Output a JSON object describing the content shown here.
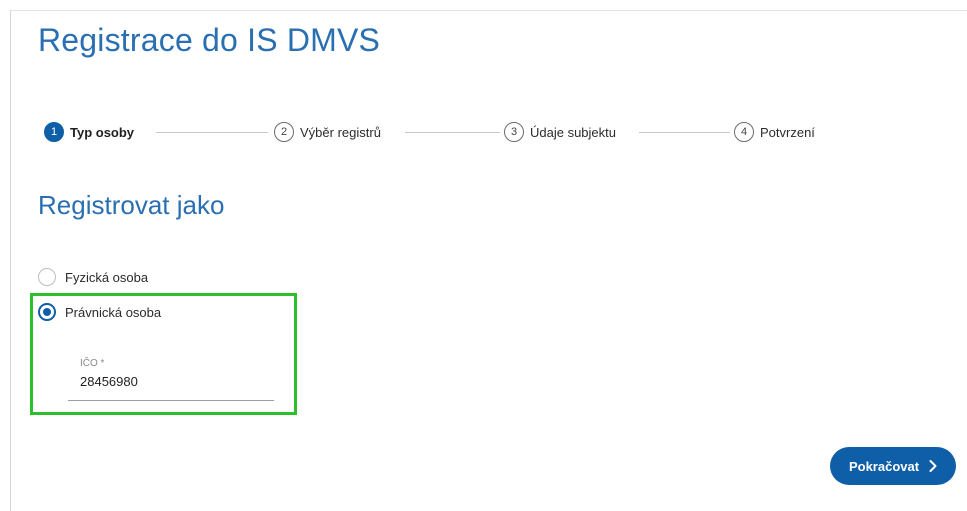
{
  "page": {
    "title": "Registrace do IS DMVS"
  },
  "stepper": {
    "steps": [
      {
        "number": "1",
        "label": "Typ osoby",
        "active": true
      },
      {
        "number": "2",
        "label": "Výběr registrů",
        "active": false
      },
      {
        "number": "3",
        "label": "Údaje subjektu",
        "active": false
      },
      {
        "number": "4",
        "label": "Potvrzení",
        "active": false
      }
    ]
  },
  "form": {
    "section_title": "Registrovat jako",
    "options": [
      {
        "label": "Fyzická osoba",
        "selected": false
      },
      {
        "label": "Právnická osoba",
        "selected": true
      }
    ],
    "ico": {
      "label": "IČO *",
      "value": "28456980"
    }
  },
  "actions": {
    "continue_label": "Pokračovat"
  },
  "colors": {
    "accent": "#0f5ea8",
    "title": "#2a6fb2",
    "highlight": "#2bbf2b"
  }
}
